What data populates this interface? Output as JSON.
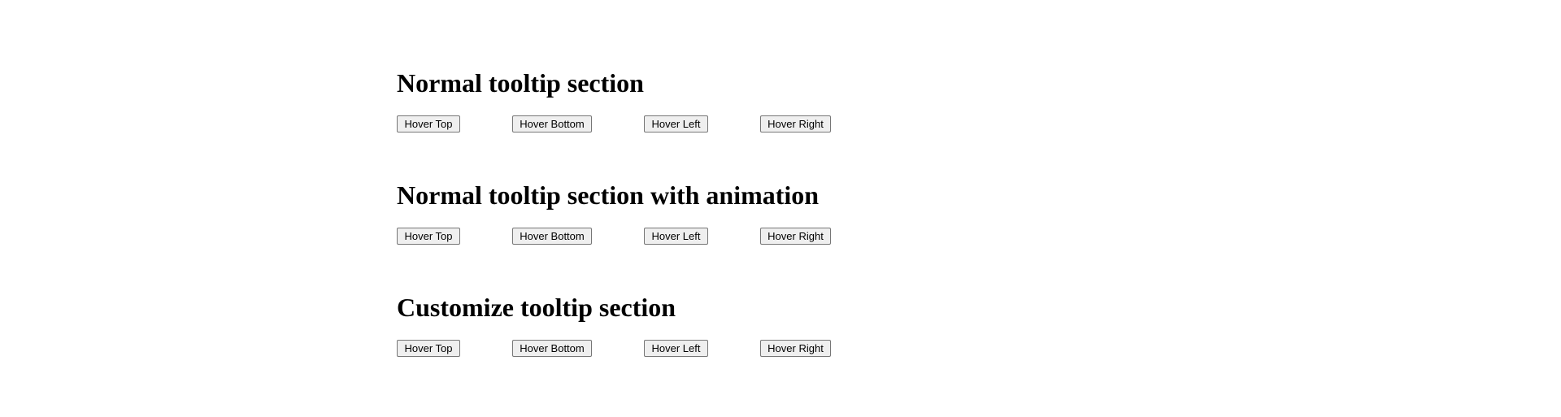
{
  "sections": [
    {
      "title": "Normal tooltip section",
      "buttons": {
        "top": "Hover Top",
        "bottom": "Hover Bottom",
        "left": "Hover Left",
        "right": "Hover Right"
      }
    },
    {
      "title": "Normal tooltip section with animation",
      "buttons": {
        "top": "Hover Top",
        "bottom": "Hover Bottom",
        "left": "Hover Left",
        "right": "Hover Right"
      }
    },
    {
      "title": "Customize tooltip section",
      "buttons": {
        "top": "Hover Top",
        "bottom": "Hover Bottom",
        "left": "Hover Left",
        "right": "Hover Right"
      }
    }
  ]
}
